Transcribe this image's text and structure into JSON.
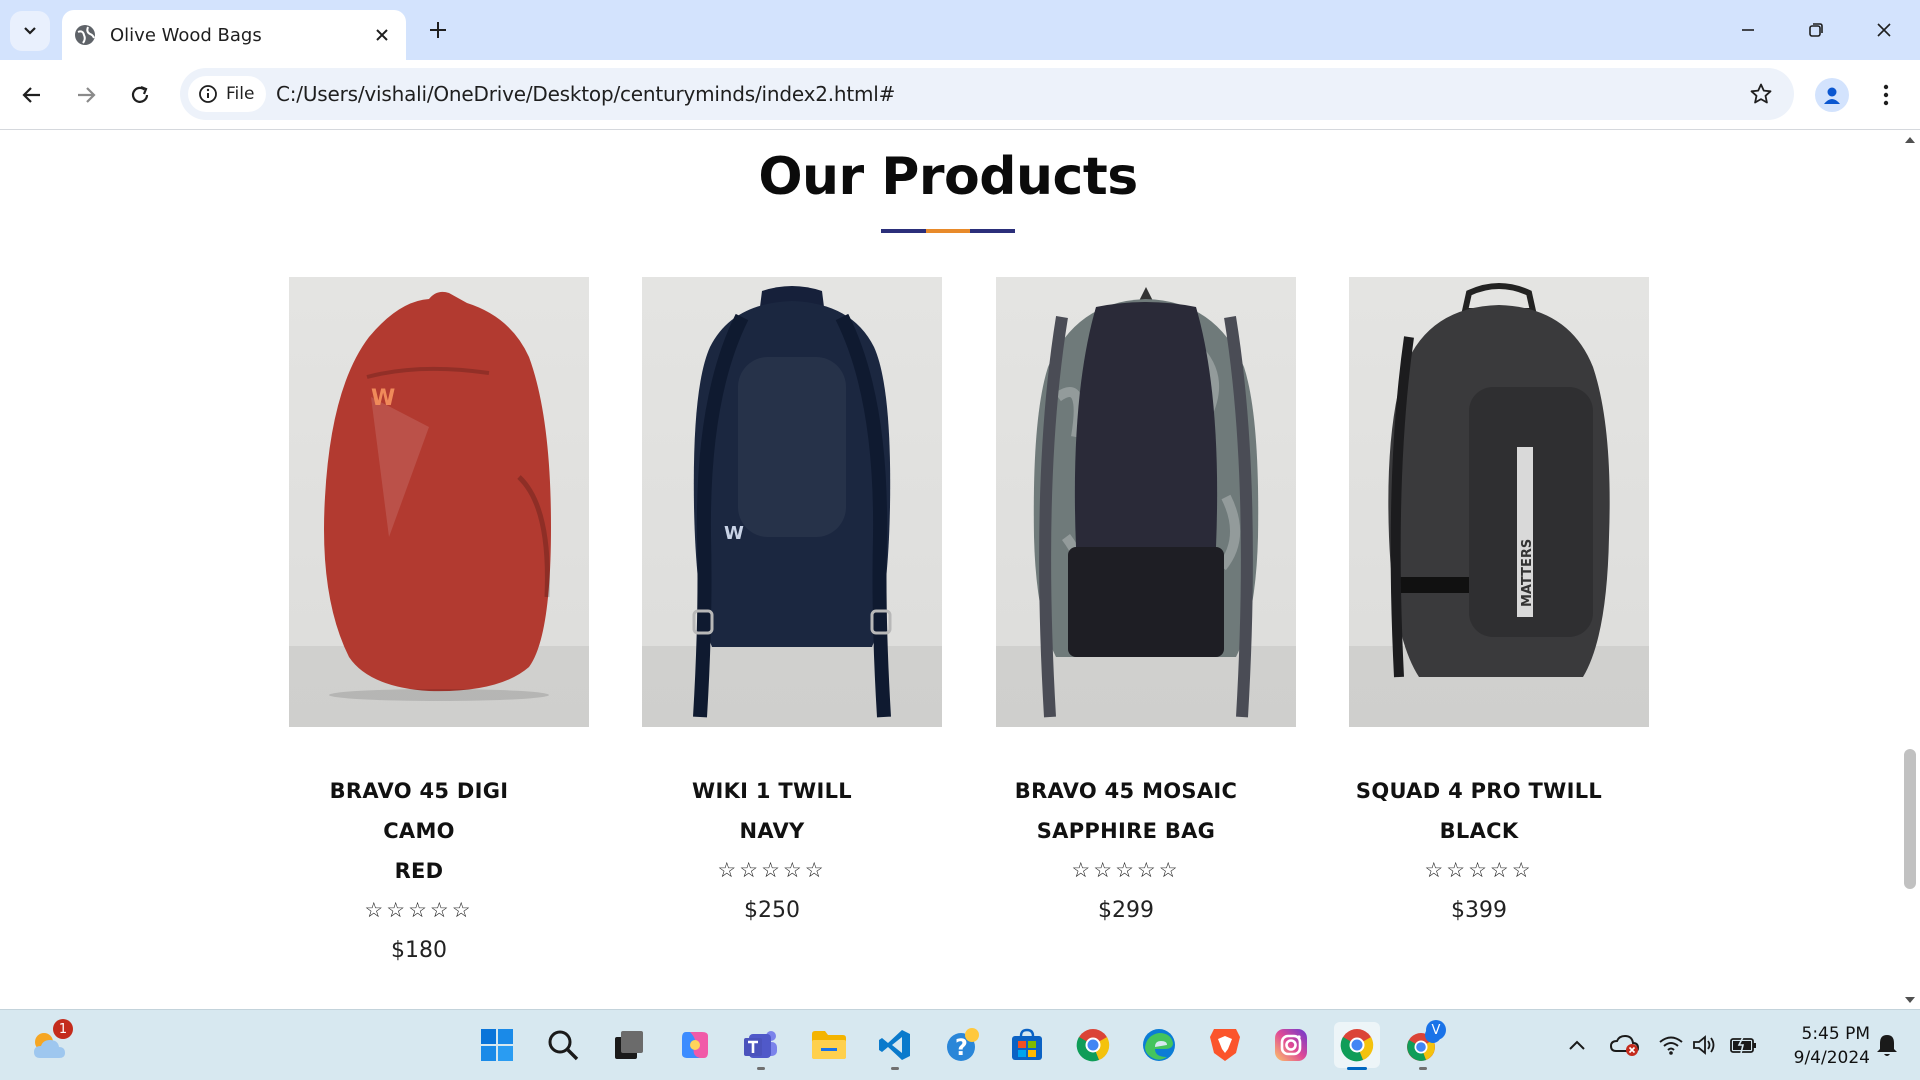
{
  "browser": {
    "tab_title": "Olive Wood Bags",
    "address_chip": "File",
    "url": "C:/Users/vishali/OneDrive/Desktop/centuryminds/index2.html#"
  },
  "page": {
    "heading": "Our Products",
    "underline_colors": [
      "#2b2f7a",
      "#e88a2a",
      "#2b2f7a"
    ],
    "products": [
      {
        "name_lines": [
          "BRAVO 45 DIGI",
          "CAMO",
          "RED"
        ],
        "stars": "☆☆☆☆☆",
        "price": "$180",
        "bag_color": "#b23a30"
      },
      {
        "name_lines": [
          "WIKI 1 TWILL",
          "NAVY"
        ],
        "stars": "☆☆☆☆☆",
        "price": "$250",
        "bag_color": "#1b2740"
      },
      {
        "name_lines": [
          "BRAVO 45 MOSAIC",
          "SAPPHIRE BAG"
        ],
        "stars": "☆☆☆☆☆",
        "price": "$299",
        "bag_color": "#6f7a7a"
      },
      {
        "name_lines": [
          "SQUAD 4 PRO TWILL",
          "BLACK"
        ],
        "stars": "☆☆☆☆☆",
        "price": "$399",
        "bag_color": "#3a3a3c"
      }
    ]
  },
  "taskbar": {
    "weather_badge": "1",
    "chrome_profile_letter": "V",
    "time": "5:45 PM",
    "date": "9/4/2024"
  }
}
